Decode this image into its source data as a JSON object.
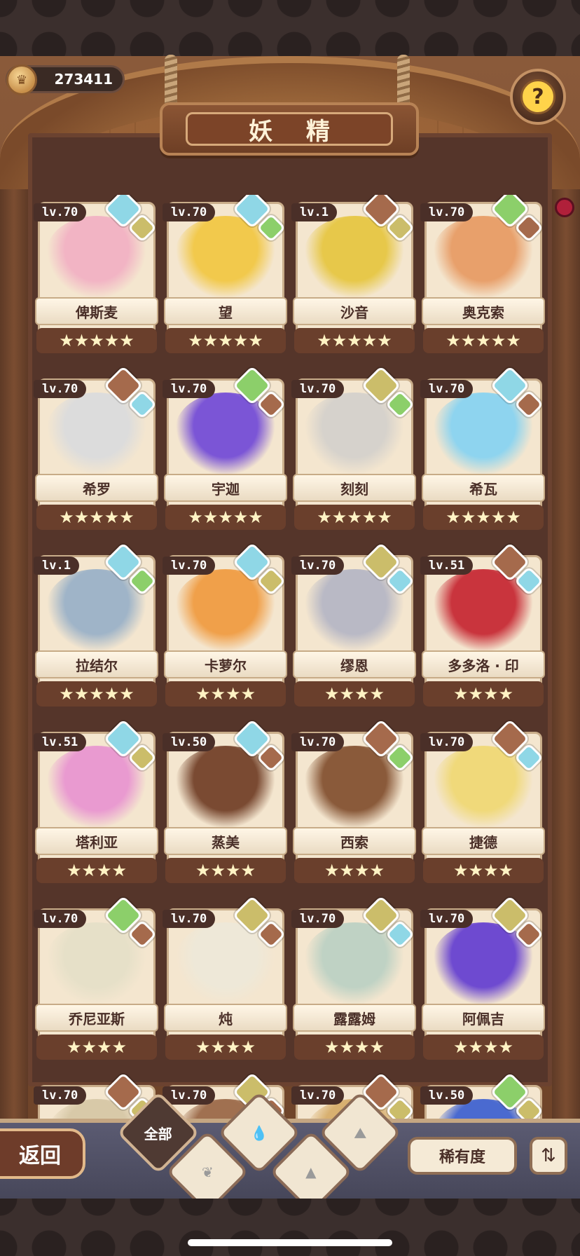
{
  "currency": {
    "value": "273411",
    "icon": "coin-icon"
  },
  "title": "妖 精",
  "help": {
    "label": "?",
    "icon": "help-icon"
  },
  "cards": [
    {
      "level": "lv.70",
      "name": "俾斯麦",
      "stars": "★★★★★",
      "element_big": "water",
      "element_small": "earth",
      "art_color": "#f2b4c4"
    },
    {
      "level": "lv.70",
      "name": "望",
      "stars": "★★★★★",
      "element_big": "water",
      "element_small": "plant",
      "art_color": "#f2c94c"
    },
    {
      "level": "lv.1",
      "name": "沙音",
      "stars": "★★★★★",
      "element_big": "rock",
      "element_small": "earth",
      "art_color": "#e7c84a"
    },
    {
      "level": "lv.70",
      "name": "奥克索",
      "stars": "★★★★★",
      "element_big": "plant",
      "element_small": "rock",
      "art_color": "#e8a06b"
    },
    {
      "level": "lv.70",
      "name": "希罗",
      "stars": "★★★★★",
      "element_big": "rock",
      "element_small": "water",
      "art_color": "#dcdcdc"
    },
    {
      "level": "lv.70",
      "name": "宇迦",
      "stars": "★★★★★",
      "element_big": "plant",
      "element_small": "rock",
      "art_color": "#7b55d6"
    },
    {
      "level": "lv.70",
      "name": "刻刻",
      "stars": "★★★★★",
      "element_big": "earth",
      "element_small": "plant",
      "art_color": "#d6d2cc"
    },
    {
      "level": "lv.70",
      "name": "希瓦",
      "stars": "★★★★★",
      "element_big": "water",
      "element_small": "rock",
      "art_color": "#8ed4ef"
    },
    {
      "level": "lv.1",
      "name": "拉结尔",
      "stars": "★★★★★",
      "element_big": "water",
      "element_small": "plant",
      "art_color": "#9fb4c8"
    },
    {
      "level": "lv.70",
      "name": "卡萝尔",
      "stars": "★★★★",
      "element_big": "water",
      "element_small": "earth",
      "art_color": "#f0a04a"
    },
    {
      "level": "lv.70",
      "name": "缪恩",
      "stars": "★★★★",
      "element_big": "earth",
      "element_small": "water",
      "art_color": "#b9b9c5"
    },
    {
      "level": "lv.51",
      "name": "多多洛 · 印",
      "stars": "★★★★",
      "element_big": "rock",
      "element_small": "water",
      "art_color": "#c9343d"
    },
    {
      "level": "lv.51",
      "name": "塔利亚",
      "stars": "★★★★",
      "element_big": "water",
      "element_small": "earth",
      "art_color": "#e99ad0"
    },
    {
      "level": "lv.50",
      "name": "蒸美",
      "stars": "★★★★",
      "element_big": "water",
      "element_small": "rock",
      "art_color": "#7a4a32"
    },
    {
      "level": "lv.70",
      "name": "西索",
      "stars": "★★★★",
      "element_big": "rock",
      "element_small": "plant",
      "art_color": "#8a5a3a"
    },
    {
      "level": "lv.70",
      "name": "捷德",
      "stars": "★★★★",
      "element_big": "rock",
      "element_small": "water",
      "art_color": "#f0d97a"
    },
    {
      "level": "lv.70",
      "name": "乔尼亚斯",
      "stars": "★★★★",
      "element_big": "plant",
      "element_small": "rock",
      "art_color": "#e6e0c8"
    },
    {
      "level": "lv.70",
      "name": "炖",
      "stars": "★★★★",
      "element_big": "earth",
      "element_small": "rock",
      "art_color": "#eee8d8"
    },
    {
      "level": "lv.70",
      "name": "露露姆",
      "stars": "★★★★",
      "element_big": "earth",
      "element_small": "water",
      "art_color": "#bfd2c4"
    },
    {
      "level": "lv.70",
      "name": "阿佩吉",
      "stars": "★★★★",
      "element_big": "earth",
      "element_small": "rock",
      "art_color": "#6e4ad0"
    },
    {
      "level": "lv.70",
      "name": "",
      "stars": "",
      "element_big": "rock",
      "element_small": "earth",
      "art_color": "#d8c9a8"
    },
    {
      "level": "lv.70",
      "name": "",
      "stars": "",
      "element_big": "earth",
      "element_small": "rock",
      "art_color": "#a07050"
    },
    {
      "level": "lv.70",
      "name": "",
      "stars": "",
      "element_big": "rock",
      "element_small": "earth",
      "art_color": "#d8b070"
    },
    {
      "level": "lv.50",
      "name": "",
      "stars": "",
      "element_big": "plant",
      "element_small": "earth",
      "art_color": "#4a6ad0"
    }
  ],
  "bottom": {
    "back_label": "返回",
    "filter_all_label": "全部",
    "filters": [
      "plant-icon",
      "water-icon",
      "earth-icon",
      "rock-icon"
    ],
    "sort_label": "稀有度",
    "order_icon": "sort-order-icon",
    "order_label": "⇅"
  },
  "colors": {
    "water": "#8fd7e6",
    "earth": "#cbbd6a",
    "plant": "#8ccf6a",
    "rock": "#a56a4c",
    "wood": "#7a4c31",
    "card": "#f4e6cf",
    "star_bar": "#6a3f2c"
  }
}
